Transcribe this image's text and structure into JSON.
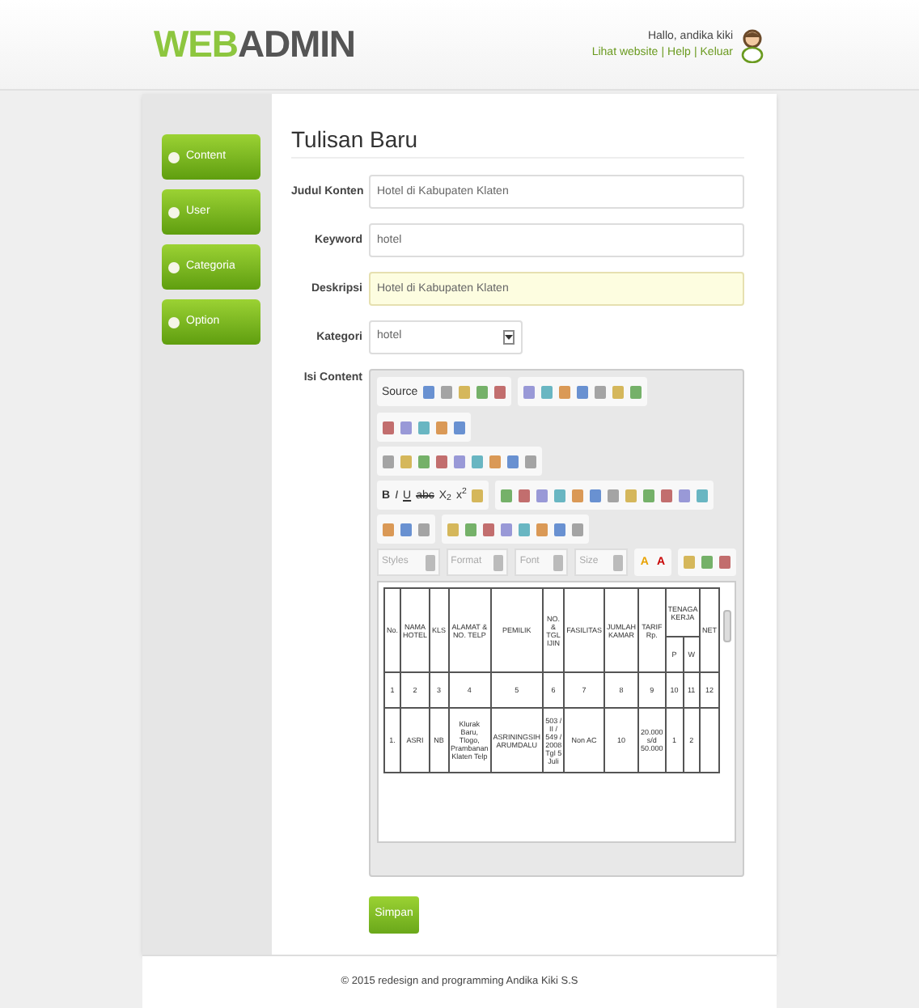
{
  "header": {
    "logo_a": "WEB",
    "logo_b": "ADMIN",
    "greeting": "Hallo, andika kiki",
    "links": [
      {
        "label": "Lihat website"
      },
      {
        "label": "Help"
      },
      {
        "label": "Keluar"
      }
    ],
    "separator": "|"
  },
  "sidebar": {
    "items": [
      {
        "label": "Content"
      },
      {
        "label": "User"
      },
      {
        "label": "Categoria"
      },
      {
        "label": "Option"
      }
    ]
  },
  "page_title": "Tulisan Baru",
  "form": {
    "fields": [
      {
        "kind": "input",
        "label": "Judul Konten",
        "value": "Hotel di Kabupaten Klaten",
        "focused": false
      },
      {
        "kind": "input",
        "label": "Keyword",
        "value": "hotel",
        "focused": false
      },
      {
        "kind": "input",
        "label": "Deskripsi",
        "value": "Hotel di Kabupaten Klaten",
        "focused": true
      },
      {
        "kind": "select",
        "label": "Kategori",
        "value": "hotel"
      },
      {
        "kind": "editor",
        "label": "Isi Content"
      }
    ]
  },
  "editor": {
    "toolbar_rows": [
      [
        [
          {
            "kind": "text",
            "label": "Source"
          },
          {
            "kind": "icon"
          },
          {
            "kind": "icon"
          },
          {
            "kind": "icon"
          },
          {
            "kind": "icon"
          },
          {
            "kind": "icon"
          }
        ],
        [
          {
            "kind": "icon"
          },
          {
            "kind": "icon"
          },
          {
            "kind": "icon"
          },
          {
            "kind": "icon"
          },
          {
            "kind": "icon"
          },
          {
            "kind": "icon"
          },
          {
            "kind": "icon"
          }
        ],
        [
          {
            "kind": "icon"
          },
          {
            "kind": "icon"
          },
          {
            "kind": "icon"
          },
          {
            "kind": "icon"
          },
          {
            "kind": "icon"
          }
        ]
      ],
      [
        [
          {
            "kind": "icon"
          },
          {
            "kind": "icon"
          },
          {
            "kind": "icon"
          },
          {
            "kind": "icon"
          },
          {
            "kind": "icon"
          },
          {
            "kind": "icon"
          },
          {
            "kind": "icon"
          },
          {
            "kind": "icon"
          },
          {
            "kind": "icon"
          }
        ]
      ],
      [
        [
          {
            "kind": "bold",
            "label": "B"
          },
          {
            "kind": "italic",
            "label": "I"
          },
          {
            "kind": "underline",
            "label": "U"
          },
          {
            "kind": "strike",
            "label": "abc"
          },
          {
            "kind": "text",
            "label": "X$_{2}$"
          },
          {
            "kind": "text",
            "label": "x$^{2}$"
          },
          {
            "kind": "icon"
          }
        ],
        [
          {
            "kind": "icon"
          },
          {
            "kind": "icon"
          },
          {
            "kind": "icon"
          },
          {
            "kind": "icon"
          },
          {
            "kind": "icon"
          },
          {
            "kind": "icon"
          },
          {
            "kind": "icon"
          },
          {
            "kind": "icon"
          },
          {
            "kind": "icon"
          },
          {
            "kind": "icon"
          },
          {
            "kind": "icon"
          },
          {
            "kind": "icon"
          }
        ]
      ],
      [
        [
          {
            "kind": "icon"
          },
          {
            "kind": "icon"
          },
          {
            "kind": "icon"
          }
        ],
        [
          {
            "kind": "icon"
          },
          {
            "kind": "icon"
          },
          {
            "kind": "icon"
          },
          {
            "kind": "icon"
          },
          {
            "kind": "icon"
          },
          {
            "kind": "icon"
          },
          {
            "kind": "icon"
          },
          {
            "kind": "icon"
          }
        ]
      ]
    ],
    "combos": [
      {
        "placeholder": "Styles"
      },
      {
        "placeholder": "Format"
      },
      {
        "placeholder": "Font"
      },
      {
        "placeholder": "Size"
      }
    ],
    "color_buttons": [
      {
        "label": "A",
        "color": "#e8a200"
      },
      {
        "label": "A",
        "color": "#c80000"
      }
    ],
    "extra_icons": [
      {
        "kind": "icon"
      },
      {
        "kind": "icon"
      },
      {
        "kind": "icon"
      }
    ],
    "table": {
      "header_rows": [
        [
          {
            "label": "No.",
            "rowspan": 2
          },
          {
            "label": "NAMA HOTEL",
            "rowspan": 2
          },
          {
            "label": "KLS",
            "rowspan": 2
          },
          {
            "label": "ALAMAT & NO. TELP",
            "rowspan": 2
          },
          {
            "label": "PEMILIK",
            "rowspan": 2
          },
          {
            "label": "NO. & TGL IJIN",
            "rowspan": 2
          },
          {
            "label": "FASILITAS",
            "rowspan": 2
          },
          {
            "label": "JUMLAH KAMAR",
            "rowspan": 2
          },
          {
            "label": "TARIF Rp.",
            "rowspan": 2
          },
          {
            "label": "TENAGA KERJA",
            "colspan": 2
          },
          {
            "label": "NET",
            "rowspan": 2
          }
        ],
        [
          {
            "label": "P"
          },
          {
            "label": "W"
          }
        ]
      ],
      "rows": [
        [
          "1",
          "2",
          "3",
          "4",
          "5",
          "6",
          "7",
          "8",
          "9",
          "10",
          "11",
          "12"
        ],
        [
          "1.",
          "ASRI",
          "NB",
          "Klurak Baru, Tlogo, Prambanan Klaten Telp",
          "ASRININGSIH ARUMDALU",
          "503 / II / 549 / 2008 Tgl 5 Juli",
          "Non AC",
          "10",
          "20.000 s/d 50.000",
          "1",
          "2",
          ""
        ]
      ]
    }
  },
  "save_button": "Simpan",
  "footer": "© 2015 redesign and programming Andika Kiki S.S"
}
